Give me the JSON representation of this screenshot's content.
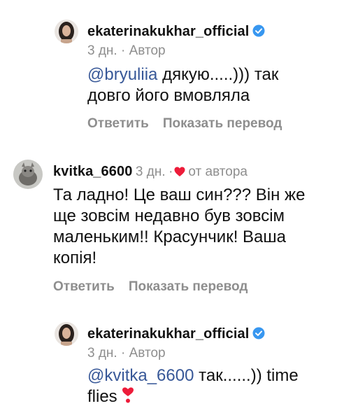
{
  "comments": [
    {
      "username": "ekaterinakukhar_official",
      "time": "3 дн.",
      "separator": "·",
      "author_tag": "Автор",
      "mention": "@bryuliia",
      "text_line1": " дякую.....))) так",
      "text_line2": "довго його вмовляла",
      "reply_label": "Ответить",
      "translate_label": "Показать перевод"
    },
    {
      "username": "kvitka_6600",
      "time": "3 дн.",
      "separator": "·",
      "liked_by_author": "от автора",
      "lines": [
        "Та ладно! Це ваш син??? Він же",
        "ще зовсім недавно був зовсім",
        "маленьким!! Красунчик! Ваша",
        "копія!"
      ],
      "reply_label": "Ответить",
      "translate_label": "Показать перевод"
    },
    {
      "username": "ekaterinakukhar_official",
      "time": "3 дн.",
      "separator": "·",
      "author_tag": "Автор",
      "mention": "@kvitka_6600",
      "text_line1": " так......)) time",
      "text_line2": "flies "
    }
  ],
  "colors": {
    "mention": "#385898",
    "muted": "#8e8e8e",
    "verified": "#3897f0",
    "heart": "#ed1c3a"
  },
  "icons": [
    "verified-badge-icon",
    "heart-icon",
    "heart-exclamation-emoji"
  ]
}
